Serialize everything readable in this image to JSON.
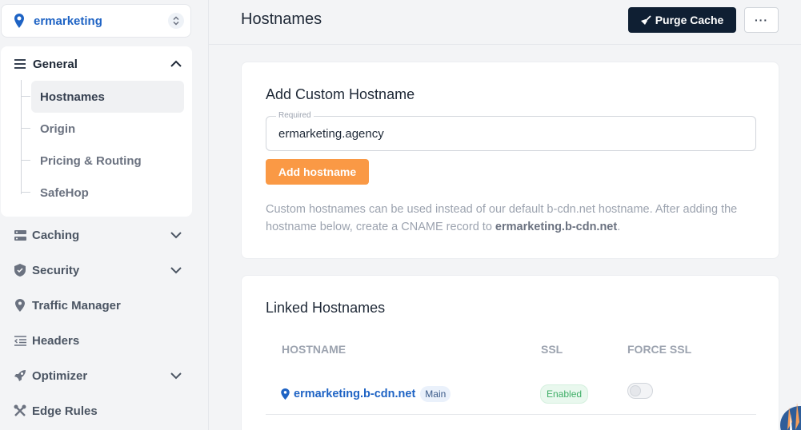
{
  "zone": {
    "name": "ermarketing"
  },
  "sidebar": {
    "general": {
      "label": "General",
      "items": [
        {
          "label": "Hostnames",
          "active": true
        },
        {
          "label": "Origin"
        },
        {
          "label": "Pricing & Routing"
        },
        {
          "label": "SafeHop"
        }
      ]
    },
    "sections": [
      {
        "label": "Caching",
        "icon": "server-icon",
        "expandable": true
      },
      {
        "label": "Security",
        "icon": "shield-icon",
        "expandable": true
      },
      {
        "label": "Traffic Manager",
        "icon": "location-pin-icon",
        "expandable": false
      },
      {
        "label": "Headers",
        "icon": "list-indent-icon",
        "expandable": false
      },
      {
        "label": "Optimizer",
        "icon": "rocket-icon",
        "expandable": true
      },
      {
        "label": "Edge Rules",
        "icon": "tools-icon",
        "expandable": false
      }
    ]
  },
  "header": {
    "title": "Hostnames",
    "purge_label": "Purge Cache",
    "more_label": "···"
  },
  "add_hostname": {
    "title": "Add Custom Hostname",
    "field_label": "Required",
    "field_value": "ermarketing.agency",
    "button_label": "Add hostname",
    "help_text": "Custom hostnames can be used instead of our default b-cdn.net hostname. After adding the hostname below, create a CNAME record to ",
    "help_bold": "ermarketing.b-cdn.net",
    "help_end": "."
  },
  "linked": {
    "title": "Linked Hostnames",
    "columns": [
      "HOSTNAME",
      "SSL",
      "FORCE SSL"
    ],
    "rows": [
      {
        "hostname": "ermarketing.b-cdn.net",
        "badge": "Main",
        "ssl": "Enabled",
        "force_ssl": false
      }
    ]
  },
  "colors": {
    "primary": "#1e63c4",
    "accent": "#fa9945",
    "dark": "#0f1f33",
    "success": "#3fae67"
  }
}
